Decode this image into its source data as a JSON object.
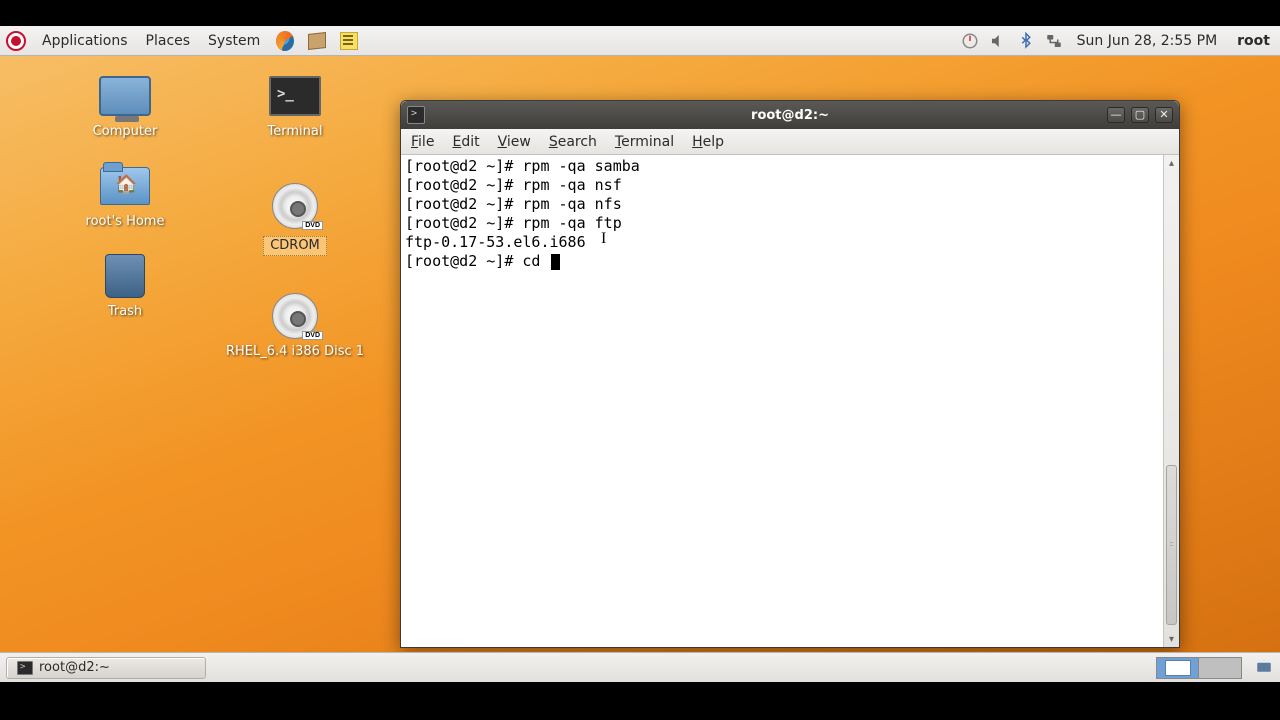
{
  "panel": {
    "menus": {
      "applications": "Applications",
      "places": "Places",
      "system": "System"
    },
    "clock": "Sun Jun 28,  2:55 PM",
    "user": "root"
  },
  "desktop_icons": {
    "computer": "Computer",
    "terminal": "Terminal",
    "home": "root's Home",
    "cdrom": "CDROM",
    "trash": "Trash",
    "disc": "RHEL_6.4 i386 Disc 1"
  },
  "window": {
    "title": "root@d2:~",
    "menus": {
      "file": "File",
      "edit": "Edit",
      "view": "View",
      "search": "Search",
      "terminal": "Terminal",
      "help": "Help"
    }
  },
  "terminal": {
    "prompt": "[root@d2 ~]# ",
    "lines": [
      "[root@d2 ~]# rpm -qa samba",
      "[root@d2 ~]# rpm -qa nsf",
      "[root@d2 ~]# rpm -qa nfs",
      "[root@d2 ~]# rpm -qa ftp",
      "ftp-0.17-53.el6.i686"
    ],
    "current_input": "cd "
  },
  "taskbar": {
    "button": "root@d2:~"
  }
}
